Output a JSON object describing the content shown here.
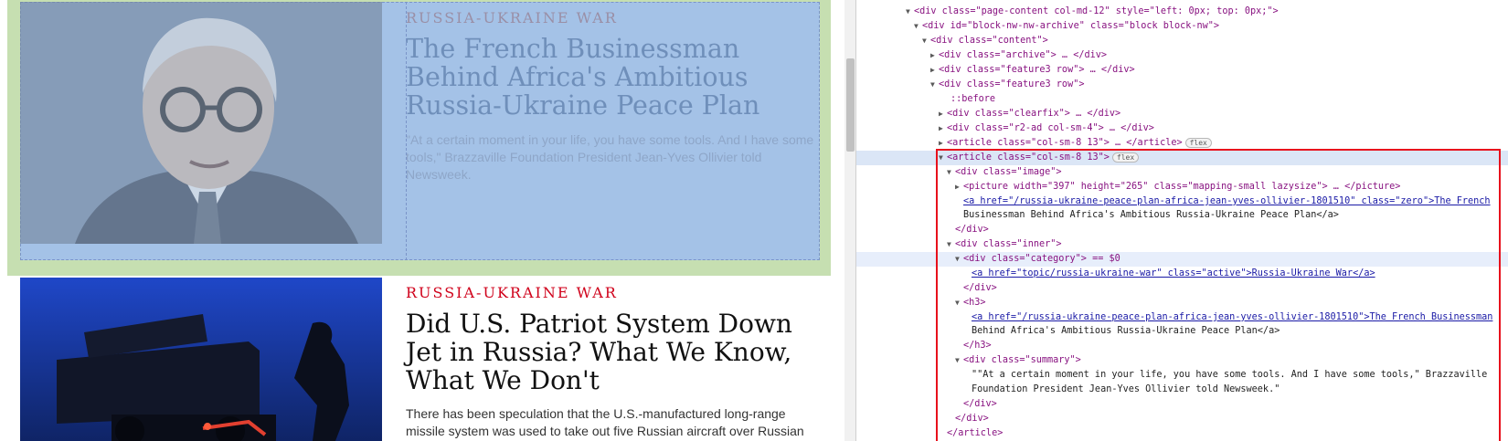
{
  "page": {
    "articles": [
      {
        "category": "Russia-Ukraine War",
        "headline": "The French Businessman Behind Africa's Ambitious Russia-Ukraine Peace Plan",
        "summary": "\"At a certain moment in your life, you have some tools. And I have some tools,\" Brazzaville Foundation President Jean-Yves Ollivier told Newsweek.",
        "image": "portrait-photo"
      },
      {
        "category": "Russia-Ukraine War",
        "headline": "Did U.S. Patriot System Down Jet in Russia? What We Know, What We Don't",
        "summary": "There has been speculation that the U.S.-manufactured long-range missile system was used to take out five Russian aircraft over Russian",
        "image": "patriot-launcher-photo"
      }
    ]
  },
  "devtools": {
    "lines": [
      {
        "t": "<div class=\"page-content col-md-12\" style=\"left: 0px; top: 0px;\">"
      },
      {
        "t": "<div id=\"block-nw-nw-archive\" class=\"block block-nw\">"
      },
      {
        "t": "<div class=\"content\">"
      },
      {
        "t": "<div class=\"archive\"> … </div>"
      },
      {
        "t": "<div class=\"feature3 row\"> … </div>"
      },
      {
        "t": "<div class=\"feature3 row\">"
      },
      {
        "t": "::before"
      },
      {
        "t": "<div class=\"clearfix\"> … </div>"
      },
      {
        "t": "<div class=\"r2-ad col-sm-4\"> … </div>"
      },
      {
        "t": "<article class=\"col-sm-8 13\"> … </article>",
        "badge": "flex"
      },
      {
        "t": "<article class=\"col-sm-8 13\">",
        "badge": "flex"
      },
      {
        "t": "<div class=\"image\">"
      },
      {
        "t": "<picture width=\"397\" height=\"265\" class=\"mapping-small lazysize\"> … </picture>"
      },
      {
        "t": "<a href=\"/russia-ukraine-peace-plan-africa-jean-yves-ollivier-1801510\" class=\"zero\">The French"
      },
      {
        "t": "Businessman Behind Africa's Ambitious Russia-Ukraine Peace Plan</a>"
      },
      {
        "t": "</div>"
      },
      {
        "t": "<div class=\"inner\">"
      },
      {
        "t": "<div class=\"category\"> == $0"
      },
      {
        "t": "<a href=\"topic/russia-ukraine-war\" class=\"active\">Russia-Ukraine War</a>"
      },
      {
        "t": "</div>"
      },
      {
        "t": "<h3>"
      },
      {
        "t": "<a href=\"/russia-ukraine-peace-plan-africa-jean-yves-ollivier-1801510\">The French Businessman"
      },
      {
        "t": "Behind Africa's Ambitious Russia-Ukraine Peace Plan</a>"
      },
      {
        "t": "</h3>"
      },
      {
        "t": "<div class=\"summary\">"
      },
      {
        "t": "\"\"At a certain moment in your life, you have some tools. And I have some tools,\" Brazzaville"
      },
      {
        "t": "Foundation President Jean-Yves Ollivier told Newsweek.\""
      },
      {
        "t": "</div>"
      },
      {
        "t": "</div>"
      },
      {
        "t": "</article>"
      }
    ],
    "gutter": "•••"
  }
}
